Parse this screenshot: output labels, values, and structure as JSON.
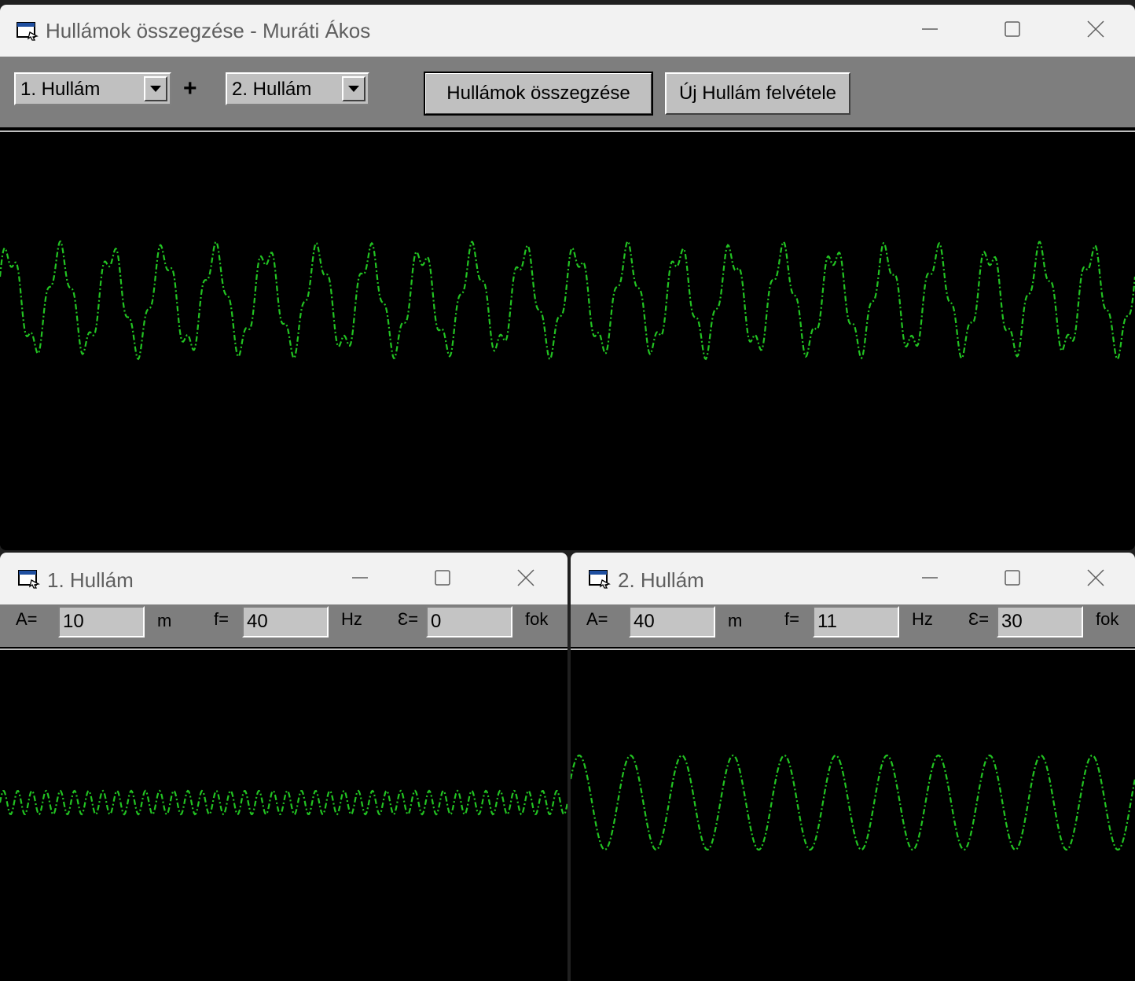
{
  "main_window": {
    "title": "Hullámok összegzése - Muráti Ákos",
    "wave_a": {
      "value": "1. Hullám"
    },
    "plus": "+",
    "wave_b": {
      "value": "2. Hullám"
    },
    "sum_button": "Hullámok összegzése",
    "new_wave_button": "Új Hullám felvétele"
  },
  "wave_windows": [
    {
      "title": "1. Hullám",
      "amplitude_label": "A=",
      "amplitude": "10",
      "amplitude_unit": "m",
      "frequency_label": "f=",
      "frequency": "40",
      "frequency_unit": "Hz",
      "phase_label": "Ɛ=",
      "phase": "0",
      "phase_unit": "fok"
    },
    {
      "title": "2. Hullám",
      "amplitude_label": "A=",
      "amplitude": "40",
      "amplitude_unit": "m",
      "frequency_label": "f=",
      "frequency": "11",
      "frequency_unit": "Hz",
      "phase_label": "Ɛ=",
      "phase": "30",
      "phase_unit": "fok"
    }
  ],
  "colors": {
    "wave_line": "#22c322",
    "plot_background": "#000000",
    "toolbar": "#7e7e7e",
    "titlebar": "#f2f2f2"
  },
  "icons": [
    "window-app-icon",
    "minimize-icon",
    "maximize-icon",
    "close-icon",
    "chevron-down-icon"
  ]
}
